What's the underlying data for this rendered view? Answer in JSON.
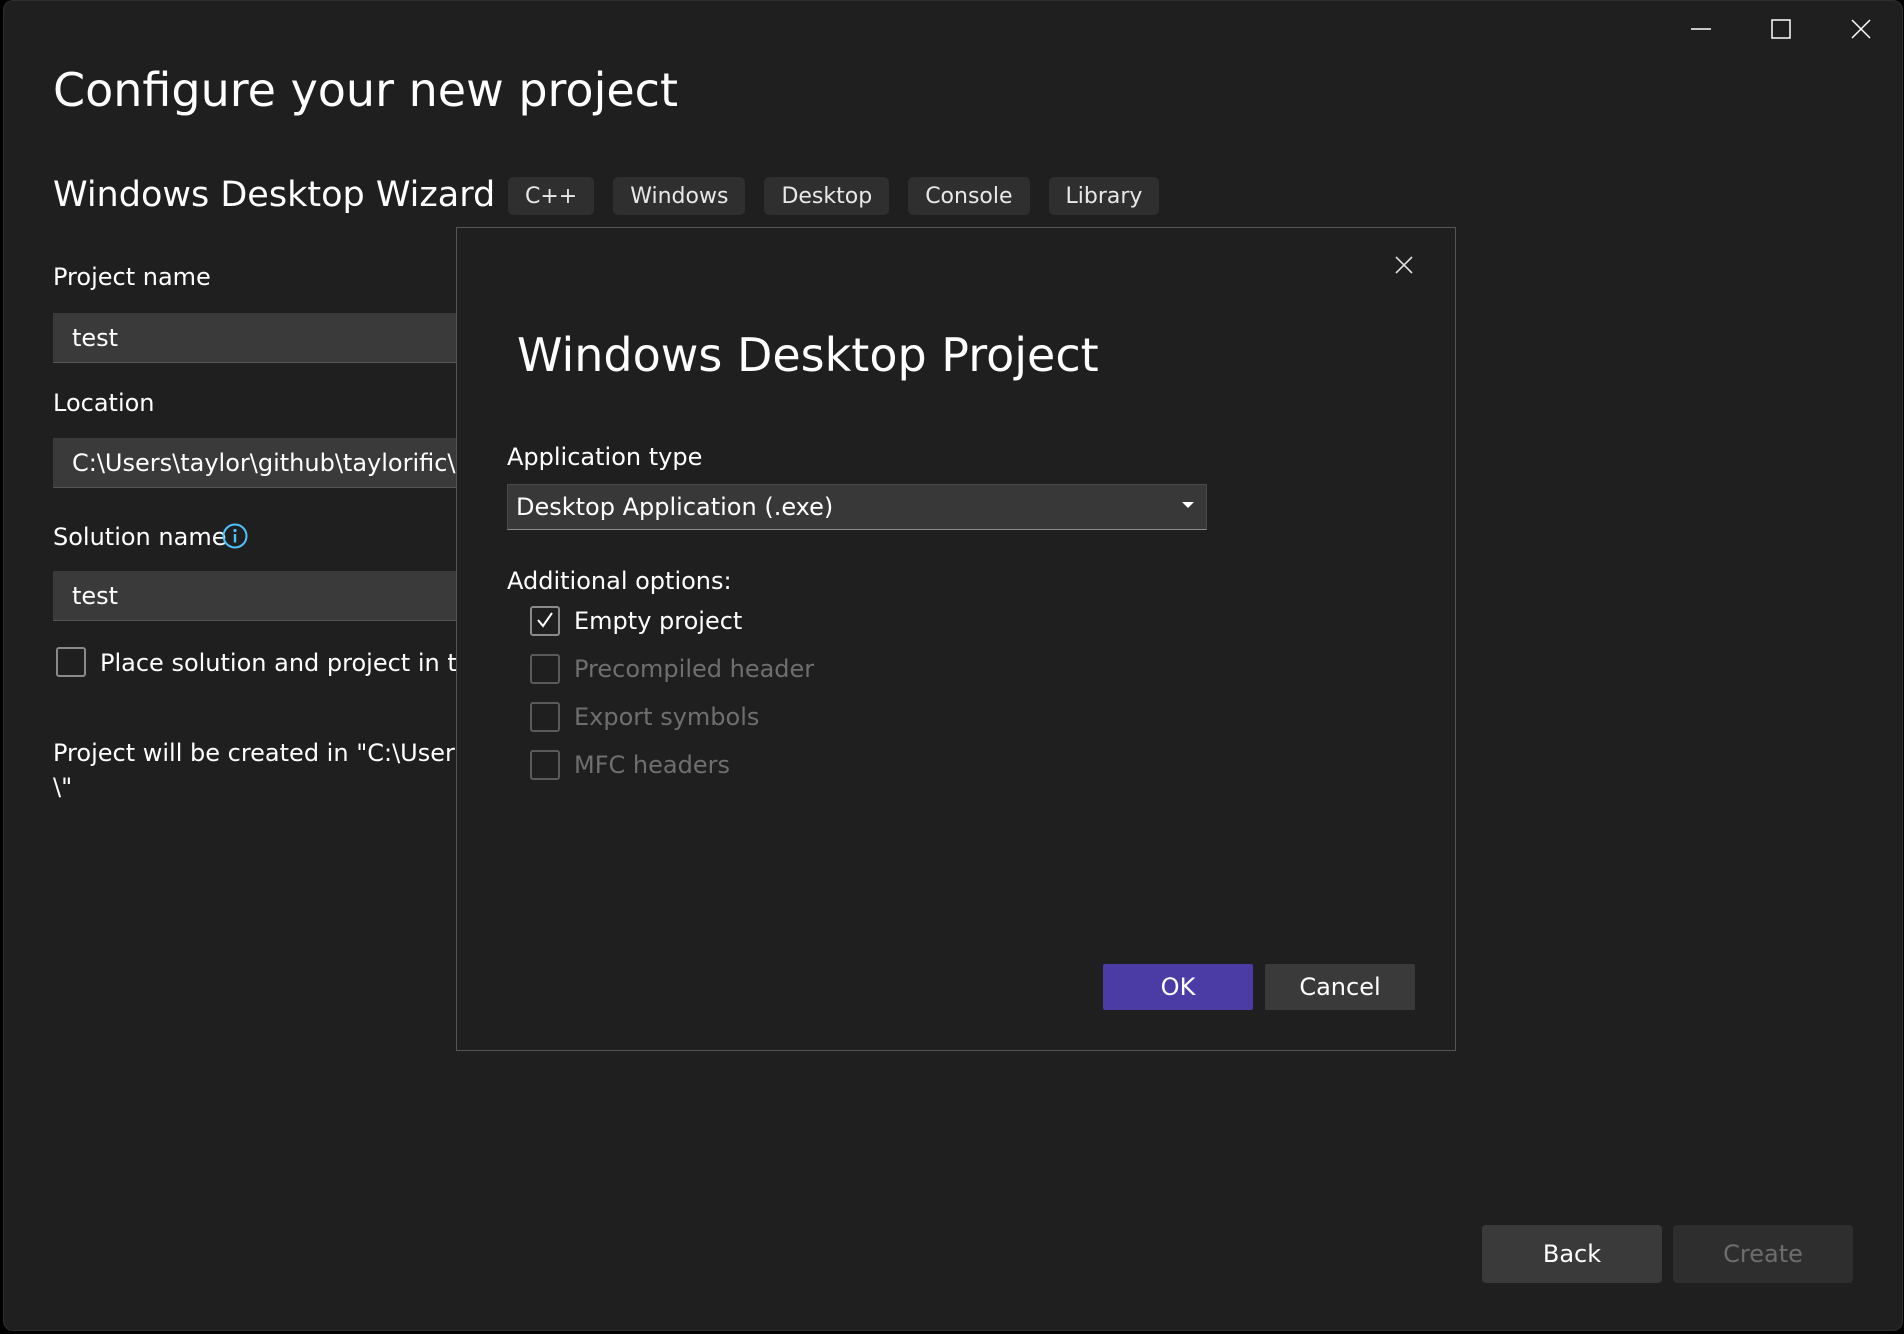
{
  "window": {
    "controls": [
      "minimize-icon",
      "maximize-icon",
      "close-icon"
    ]
  },
  "page": {
    "title": "Configure your new project",
    "wizard_name": "Windows Desktop Wizard",
    "tags": [
      "C++",
      "Windows",
      "Desktop",
      "Console",
      "Library"
    ]
  },
  "form": {
    "project_name_label": "Project name",
    "project_name_value": "test",
    "location_label": "Location",
    "location_value": "C:\\Users\\taylor\\github\\taylorific\\han",
    "solution_name_label": "Solution name",
    "solution_name_value": "test",
    "same_dir_label": "Place solution and project in the s",
    "same_dir_checked": false,
    "created_in_line1": "Project will be created in \"C:\\Users\\tay",
    "created_in_line2": "\\\""
  },
  "footer": {
    "back_label": "Back",
    "create_label": "Create"
  },
  "modal": {
    "title": "Windows Desktop Project",
    "app_type_label": "Application type",
    "app_type_value": "Desktop Application (.exe)",
    "additional_label": "Additional options:",
    "options": [
      {
        "label": "Empty project",
        "checked": true,
        "enabled": true
      },
      {
        "label": "Precompiled header",
        "checked": false,
        "enabled": false
      },
      {
        "label": "Export symbols",
        "checked": false,
        "enabled": false
      },
      {
        "label": "MFC headers",
        "checked": false,
        "enabled": false
      }
    ],
    "ok_label": "OK",
    "cancel_label": "Cancel"
  },
  "colors": {
    "background": "#1f1f1f",
    "accent": "#4b3ca5",
    "info": "#4cc2ff"
  }
}
